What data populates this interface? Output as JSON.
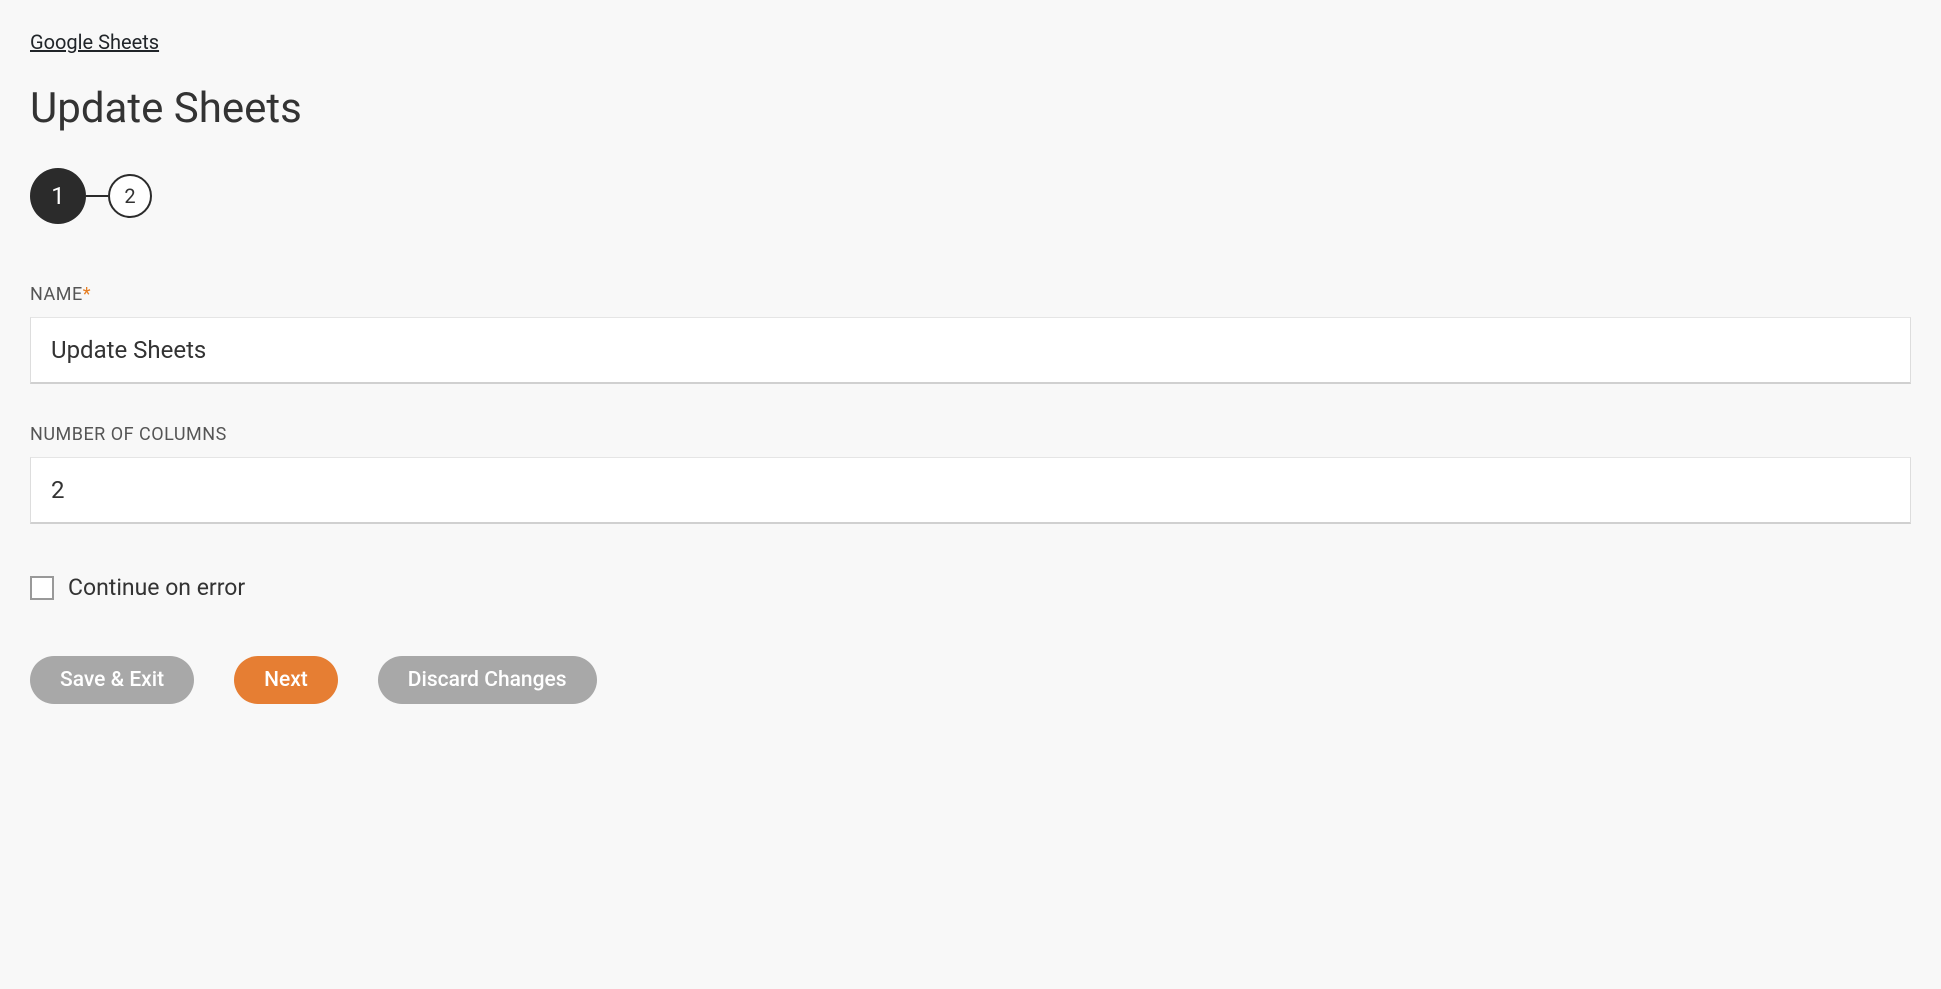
{
  "breadcrumb": {
    "label": "Google Sheets"
  },
  "page": {
    "title": "Update Sheets"
  },
  "stepper": {
    "steps": [
      {
        "number": "1",
        "active": true
      },
      {
        "number": "2",
        "active": false
      }
    ]
  },
  "form": {
    "name": {
      "label": "NAME",
      "required": true,
      "value": "Update Sheets"
    },
    "columns": {
      "label": "NUMBER OF COLUMNS",
      "required": false,
      "value": "2"
    },
    "continueOnError": {
      "label": "Continue on error",
      "checked": false
    }
  },
  "buttons": {
    "saveExit": "Save & Exit",
    "next": "Next",
    "discard": "Discard Changes"
  }
}
